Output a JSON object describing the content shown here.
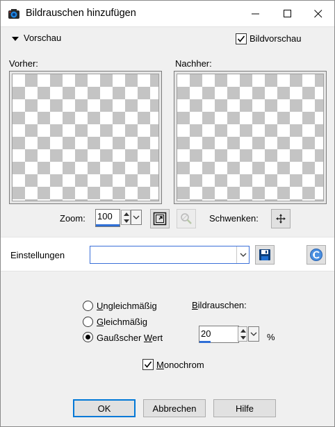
{
  "window": {
    "title": "Bildrauschen hinzufügen"
  },
  "preview": {
    "section_label": "Vorschau",
    "show_preview_label": "Bildvorschau",
    "show_preview_checked": true,
    "before_label": "Vorher:",
    "after_label": "Nachher:",
    "zoom_label": "Zoom:",
    "zoom_value": "100",
    "pan_label": "Schwenken:"
  },
  "settings": {
    "label": "Einstellungen",
    "preset_value": ""
  },
  "noise": {
    "distribution_options": [
      {
        "label_u": "U",
        "label_rest": "ngleichmäßig",
        "selected": false
      },
      {
        "label_u": "G",
        "label_rest": "leichmäßig",
        "selected": false
      },
      {
        "label_pre": "Gaußscher ",
        "label_u": "W",
        "label_rest": "ert",
        "selected": true
      }
    ],
    "amount_label_u": "B",
    "amount_label_rest": "ildrauschen:",
    "amount_value": "20",
    "amount_unit": "%",
    "monochrome_label_u": "M",
    "monochrome_label_rest": "onochrom",
    "monochrome_checked": true
  },
  "buttons": {
    "ok": "OK",
    "cancel": "Abbrechen",
    "help": "Hilfe"
  }
}
